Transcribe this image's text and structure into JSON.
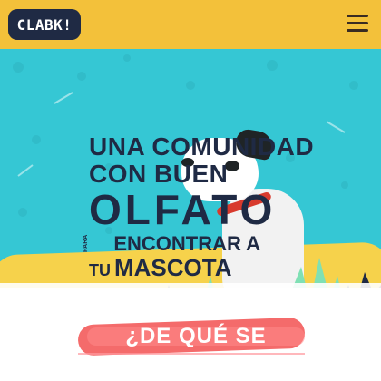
{
  "header": {
    "logo_text": "CLABK!",
    "menu_icon": "hamburger-menu-icon",
    "background": "#f3c13a"
  },
  "hero": {
    "line1": "UNA COMUNIDAD",
    "line2": "CON BUEN",
    "line3": "OLFATO",
    "small_para": "PARA",
    "line4": "ENCONTRAR A",
    "small_tu": "TU",
    "line5": "MASCOTA",
    "background": "#35c7d4",
    "accent_yellow": "#f6d24b"
  },
  "section": {
    "heading": "¿DE QUÉ SE TRATA?",
    "heading_color": "#ffffff",
    "brush_color": "#f46b6b"
  }
}
